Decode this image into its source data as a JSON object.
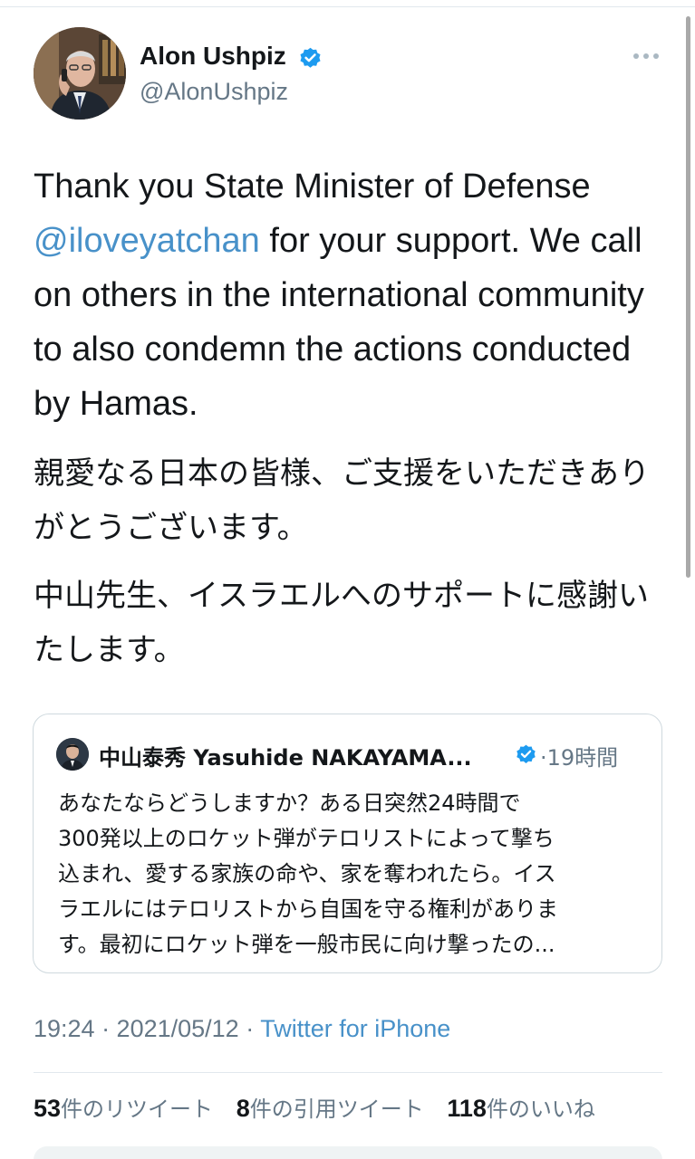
{
  "author": {
    "display_name": "Alon Ushpiz",
    "handle": "@AlonUshpiz"
  },
  "tweet": {
    "en_prefix": "Thank you State Minister of Defense ",
    "mention": "@iloveyatchan",
    "en_suffix": " for your support. We call on others in the international community to also condemn the actions conducted by Hamas.",
    "ja_paragraph_1": "親愛なる日本の皆様、ご支援をいただきありがとうございます。",
    "ja_paragraph_2": "中山先生、イスラエルへのサポートに感謝いたします。"
  },
  "quoted_tweet": {
    "display_name": "中山泰秀 Yasuhide NAKAYAMA...",
    "time": "·19時間",
    "lines": [
      "あなたならどうしますか？ある日突然24時間で",
      "300発以上のロケット弾がテロリストによって撃ち",
      "込まれ、愛する家族の命や、家を奪われたら。イス",
      "ラエルにはテロリストから自国を守る権利がありま",
      "す。最初にロケット弾を一般市民に向け撃ったの..."
    ]
  },
  "meta": {
    "timestamp": "19:24 · 2021/05/12 · ",
    "source": "Twitter for iPhone"
  },
  "stats": {
    "retweets_count": "53",
    "retweets_label": "件のリツイート",
    "quotes_count": "8",
    "quotes_label": "件の引用ツイート",
    "likes_count": "118",
    "likes_label": "件のいいね"
  },
  "icons": {
    "verified": "verified-badge-icon",
    "more": "more-options-icon"
  },
  "colors": {
    "link": "#4891c9",
    "verified": "#1d9bf0",
    "secondary_text": "#657786"
  }
}
